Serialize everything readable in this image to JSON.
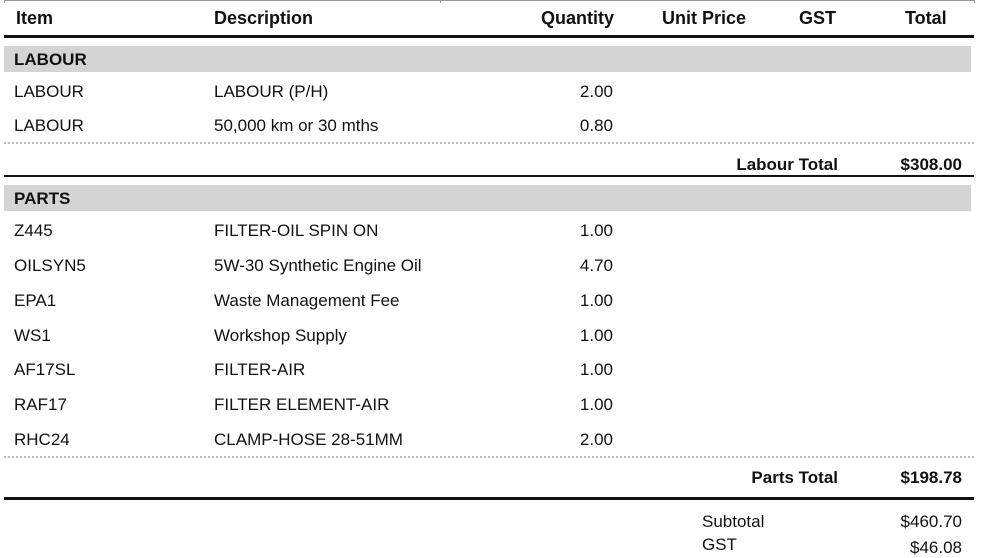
{
  "columns": {
    "item": "Item",
    "description": "Description",
    "quantity": "Quantity",
    "unit_price": "Unit Price",
    "gst": "GST",
    "total": "Total"
  },
  "labour": {
    "heading": "LABOUR",
    "rows": [
      {
        "item": "LABOUR",
        "description": "LABOUR (P/H)",
        "quantity": "2.00"
      },
      {
        "item": "LABOUR",
        "description": "50,000 km or 30 mths",
        "quantity": "0.80"
      }
    ],
    "total_label": "Labour Total",
    "total_value": "$308.00"
  },
  "parts": {
    "heading": "PARTS",
    "rows": [
      {
        "item": "Z445",
        "description": "FILTER-OIL SPIN ON",
        "quantity": "1.00"
      },
      {
        "item": "OILSYN5",
        "description": "5W-30 Synthetic Engine Oil",
        "quantity": "4.70"
      },
      {
        "item": "EPA1",
        "description": "Waste Management Fee",
        "quantity": "1.00"
      },
      {
        "item": "WS1",
        "description": "Workshop Supply",
        "quantity": "1.00"
      },
      {
        "item": "AF17SL",
        "description": "FILTER-AIR",
        "quantity": "1.00"
      },
      {
        "item": "RAF17",
        "description": "FILTER ELEMENT-AIR",
        "quantity": "1.00"
      },
      {
        "item": "RHC24",
        "description": "CLAMP-HOSE 28-51MM",
        "quantity": "2.00"
      }
    ],
    "total_label": "Parts Total",
    "total_value": "$198.78"
  },
  "summary": {
    "subtotal_label": "Subtotal",
    "subtotal_value": "$460.70",
    "gst_label": "GST",
    "gst_value": "$46.08"
  }
}
